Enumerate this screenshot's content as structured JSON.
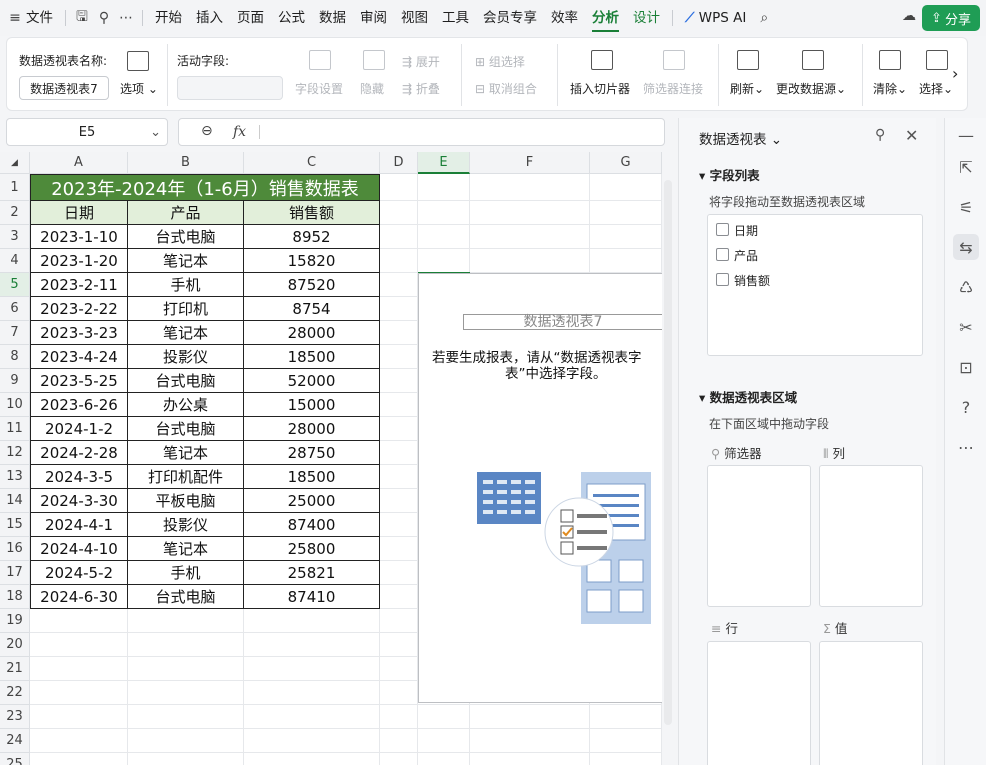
{
  "menubar": {
    "file": "文件",
    "items": [
      "开始",
      "插入",
      "页面",
      "公式",
      "数据",
      "审阅",
      "视图",
      "工具",
      "会员专享",
      "效率"
    ],
    "active": "分析",
    "design": "设计",
    "wps_ai": "WPS AI",
    "share": "分享"
  },
  "ribbon": {
    "pivot_name_label": "数据透视表名称:",
    "pivot_name": "数据透视表7",
    "options": "选项",
    "active_field_label": "活动字段:",
    "field_settings": "字段设置",
    "hide": "隐藏",
    "expand": "展开",
    "collapse": "折叠",
    "group_select": "组选择",
    "ungroup": "取消组合",
    "insert_slicer": "插入切片器",
    "filter_connect": "筛选器连接",
    "refresh": "刷新",
    "change_source": "更改数据源",
    "clear": "清除",
    "select": "选择"
  },
  "formula": {
    "cell_ref": "E5",
    "fx": "fx"
  },
  "columns": [
    "A",
    "B",
    "C",
    "D",
    "E",
    "F",
    "G"
  ],
  "rows": [
    "1",
    "2",
    "3",
    "4",
    "5",
    "6",
    "7",
    "8",
    "9",
    "10",
    "11",
    "12",
    "13",
    "14",
    "15",
    "16",
    "17",
    "18",
    "19",
    "20",
    "21",
    "22",
    "23",
    "24",
    "25"
  ],
  "table": {
    "title": "2023年-2024年（1-6月）销售数据表",
    "headers": [
      "日期",
      "产品",
      "销售额"
    ],
    "data": [
      [
        "2023-1-10",
        "台式电脑",
        "8952"
      ],
      [
        "2023-1-20",
        "笔记本",
        "15820"
      ],
      [
        "2023-2-11",
        "手机",
        "87520"
      ],
      [
        "2023-2-22",
        "打印机",
        "8754"
      ],
      [
        "2023-3-23",
        "笔记本",
        "28000"
      ],
      [
        "2023-4-24",
        "投影仪",
        "18500"
      ],
      [
        "2023-5-25",
        "台式电脑",
        "52000"
      ],
      [
        "2023-6-26",
        "办公桌",
        "15000"
      ],
      [
        "2024-1-2",
        "台式电脑",
        "28000"
      ],
      [
        "2024-2-28",
        "笔记本",
        "28750"
      ],
      [
        "2024-3-5",
        "打印机配件",
        "18500"
      ],
      [
        "2024-3-30",
        "平板电脑",
        "25000"
      ],
      [
        "2024-4-1",
        "投影仪",
        "87400"
      ],
      [
        "2024-4-10",
        "笔记本",
        "25800"
      ],
      [
        "2024-5-2",
        "手机",
        "25821"
      ],
      [
        "2024-6-30",
        "台式电脑",
        "87410"
      ]
    ]
  },
  "pivot": {
    "name": "数据透视表7",
    "hint1": "若要生成报表，请从“数据透视表字",
    "hint2": "表”中选择字段。"
  },
  "panel": {
    "title": "数据透视表",
    "field_list": "字段列表",
    "drag_hint": "将字段拖动至数据透视表区域",
    "fields": [
      "日期",
      "产品",
      "销售额"
    ],
    "area_title": "数据透视表区域",
    "area_hint": "在下面区域中拖动字段",
    "filter": "筛选器",
    "columns": "列",
    "rows": "行",
    "values": "值"
  },
  "colors": {
    "accent": "#1a7f37",
    "title_bg": "#4e8a3a",
    "header_bg": "#e2efda",
    "share_bg": "#1f9d55"
  }
}
